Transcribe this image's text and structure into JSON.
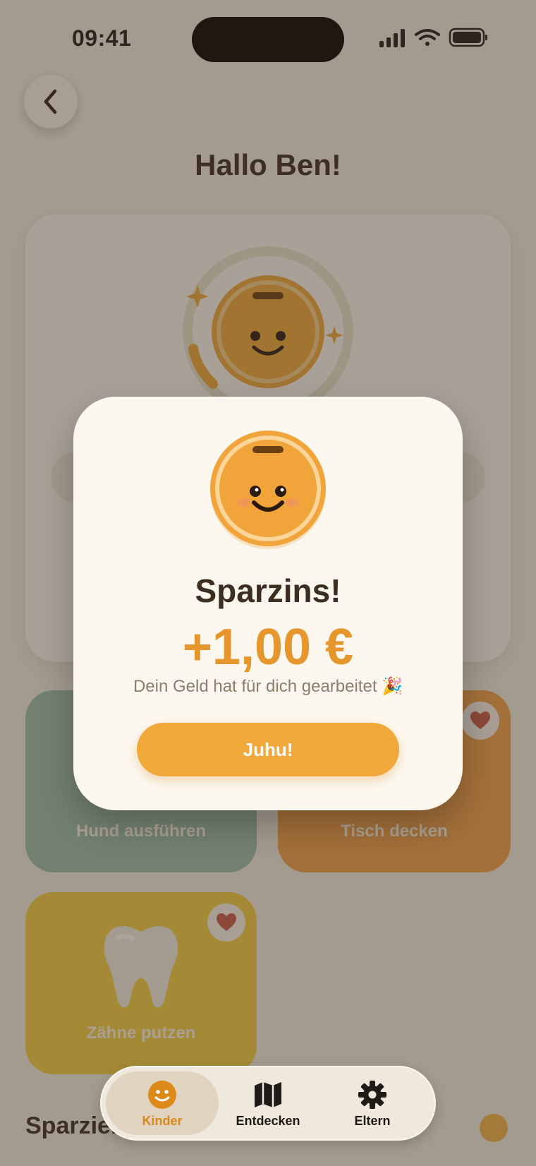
{
  "status_bar": {
    "time": "09:41"
  },
  "header": {
    "title": "Hallo Ben!"
  },
  "chores": [
    {
      "label": "Hund ausführen"
    },
    {
      "label": "Tisch decken"
    },
    {
      "label": "Zähne putzen"
    }
  ],
  "section": {
    "title": "Sparziel"
  },
  "tabbar": {
    "tabs": [
      {
        "label": "Kinder",
        "icon": "smiley-icon",
        "active": true
      },
      {
        "label": "Entdecken",
        "icon": "map-icon",
        "active": false
      },
      {
        "label": "Eltern",
        "icon": "gear-icon",
        "active": false
      }
    ]
  },
  "modal": {
    "title": "Sparzins!",
    "amount": "+1,00 €",
    "subtitle": "Dein Geld hat für dich gearbeitet 🎉",
    "button_label": "Juhu!"
  },
  "colors": {
    "accent": "#f0a83b",
    "amount": "#e5962c",
    "tile_walk": "#9cbfb0",
    "tile_table": "#f3a04c",
    "tile_teeth": "#f4cf44",
    "heart": "#c9584a"
  }
}
